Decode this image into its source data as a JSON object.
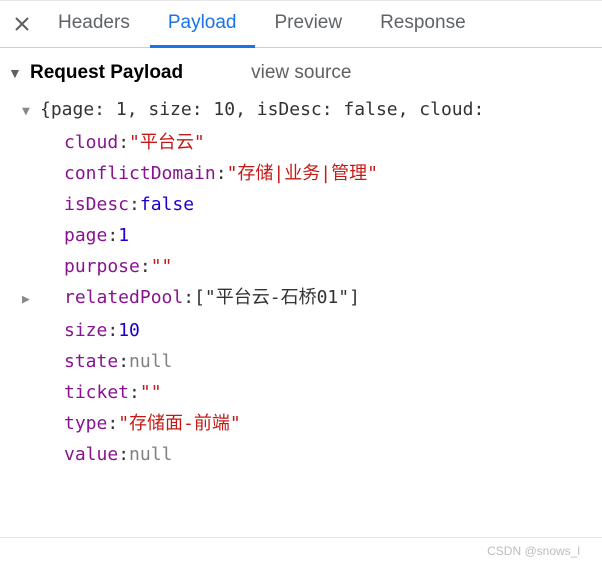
{
  "tabs": {
    "headers": "Headers",
    "payload": "Payload",
    "preview": "Preview",
    "response": "Response"
  },
  "section": {
    "title": "Request Payload",
    "view_source": "view source"
  },
  "payload": {
    "summary": "{page: 1, size: 10, isDesc: false, cloud:",
    "entries": [
      {
        "key": "cloud",
        "value": "\"平台云\"",
        "cls": "str"
      },
      {
        "key": "conflictDomain",
        "value": "\"存储|业务|管理\"",
        "cls": "str"
      },
      {
        "key": "isDesc",
        "value": "false",
        "cls": "bool"
      },
      {
        "key": "page",
        "value": "1",
        "cls": "num"
      },
      {
        "key": "purpose",
        "value": "\"\"",
        "cls": "str"
      },
      {
        "key": "relatedPool",
        "value": "[\"平台云-石桥01\"]",
        "cls": "punct",
        "expandable": true
      },
      {
        "key": "size",
        "value": "10",
        "cls": "num"
      },
      {
        "key": "state",
        "value": "null",
        "cls": "null"
      },
      {
        "key": "ticket",
        "value": "\"\"",
        "cls": "str"
      },
      {
        "key": "type",
        "value": "\"存储面-前端\"",
        "cls": "str"
      },
      {
        "key": "value",
        "value": "null",
        "cls": "null"
      }
    ]
  },
  "watermark": "CSDN @snows_l"
}
